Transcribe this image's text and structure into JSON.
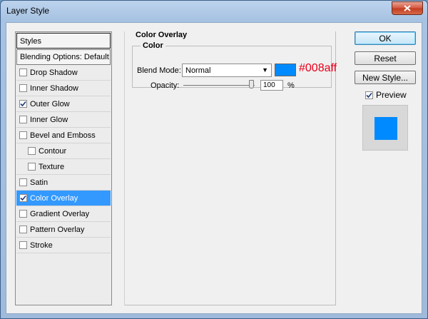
{
  "window": {
    "title": "Layer Style"
  },
  "styles_list": {
    "header": "Styles",
    "blending": "Blending Options: Default",
    "items": [
      {
        "label": "Drop Shadow",
        "checked": false,
        "sub": false,
        "selected": false
      },
      {
        "label": "Inner Shadow",
        "checked": false,
        "sub": false,
        "selected": false
      },
      {
        "label": "Outer Glow",
        "checked": true,
        "sub": false,
        "selected": false
      },
      {
        "label": "Inner Glow",
        "checked": false,
        "sub": false,
        "selected": false
      },
      {
        "label": "Bevel and Emboss",
        "checked": false,
        "sub": false,
        "selected": false
      },
      {
        "label": "Contour",
        "checked": false,
        "sub": true,
        "selected": false
      },
      {
        "label": "Texture",
        "checked": false,
        "sub": true,
        "selected": false
      },
      {
        "label": "Satin",
        "checked": false,
        "sub": false,
        "selected": false
      },
      {
        "label": "Color Overlay",
        "checked": true,
        "sub": false,
        "selected": true
      },
      {
        "label": "Gradient Overlay",
        "checked": false,
        "sub": false,
        "selected": false
      },
      {
        "label": "Pattern Overlay",
        "checked": false,
        "sub": false,
        "selected": false
      },
      {
        "label": "Stroke",
        "checked": false,
        "sub": false,
        "selected": false
      }
    ]
  },
  "overlay": {
    "section_title": "Color Overlay",
    "group_title": "Color",
    "blend_mode_label": "Blend Mode:",
    "blend_mode_value": "Normal",
    "color_hex": "#008aff",
    "swatch_color": "#008aff",
    "opacity_label": "Opacity:",
    "opacity_value": "100",
    "opacity_unit": "%"
  },
  "buttons": {
    "ok": "OK",
    "reset": "Reset",
    "new_style": "New Style...",
    "preview_label": "Preview",
    "preview_checked": true
  },
  "colors": {
    "accent": "#3399ff",
    "preview_fill": "#008aff",
    "hex_text": "#e8001c"
  }
}
